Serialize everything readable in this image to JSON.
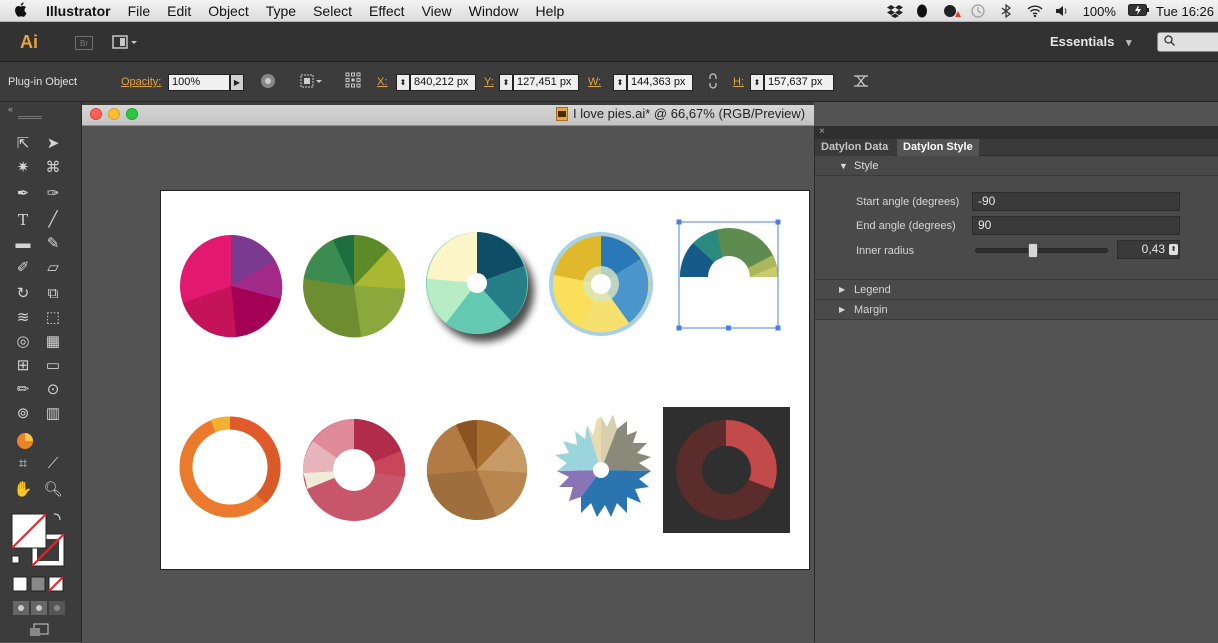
{
  "menubar": {
    "apple": "",
    "app": "Illustrator",
    "items": [
      "File",
      "Edit",
      "Object",
      "Type",
      "Select",
      "Effect",
      "View",
      "Window",
      "Help"
    ],
    "battery": "100%",
    "clock": "Tue 16:26"
  },
  "appbar": {
    "logo": "Ai",
    "bridge": "Br",
    "workspace": "Essentials",
    "workspace_caret": "▾"
  },
  "control": {
    "selection": "Plug-in Object",
    "opacity_label": "Opacity:",
    "opacity_value": "100%",
    "x_label": "X:",
    "x_value": "840,212 px",
    "y_label": "Y:",
    "y_value": "127,451 px",
    "w_label": "W:",
    "w_value": "144,363 px",
    "h_label": "H:",
    "h_value": "157,637 px"
  },
  "document": {
    "title": "I love pies.ai* @ 66,67% (RGB/Preview)"
  },
  "panel": {
    "tabs": [
      "Datylon Data",
      "Datylon Style"
    ],
    "active_tab": "Datylon Style",
    "style_header": "Style",
    "start_angle_label": "Start angle (degrees)",
    "start_angle_value": "-90",
    "end_angle_label": "End angle (degrees)",
    "end_angle_value": "90",
    "inner_radius_label": "Inner radius",
    "inner_radius_value": "0,43",
    "inner_radius_fraction": 0.43,
    "legend": "Legend",
    "margin": "Margin"
  },
  "colors": {
    "accent": "#e8a33b",
    "selection": "#4a7fe0"
  }
}
